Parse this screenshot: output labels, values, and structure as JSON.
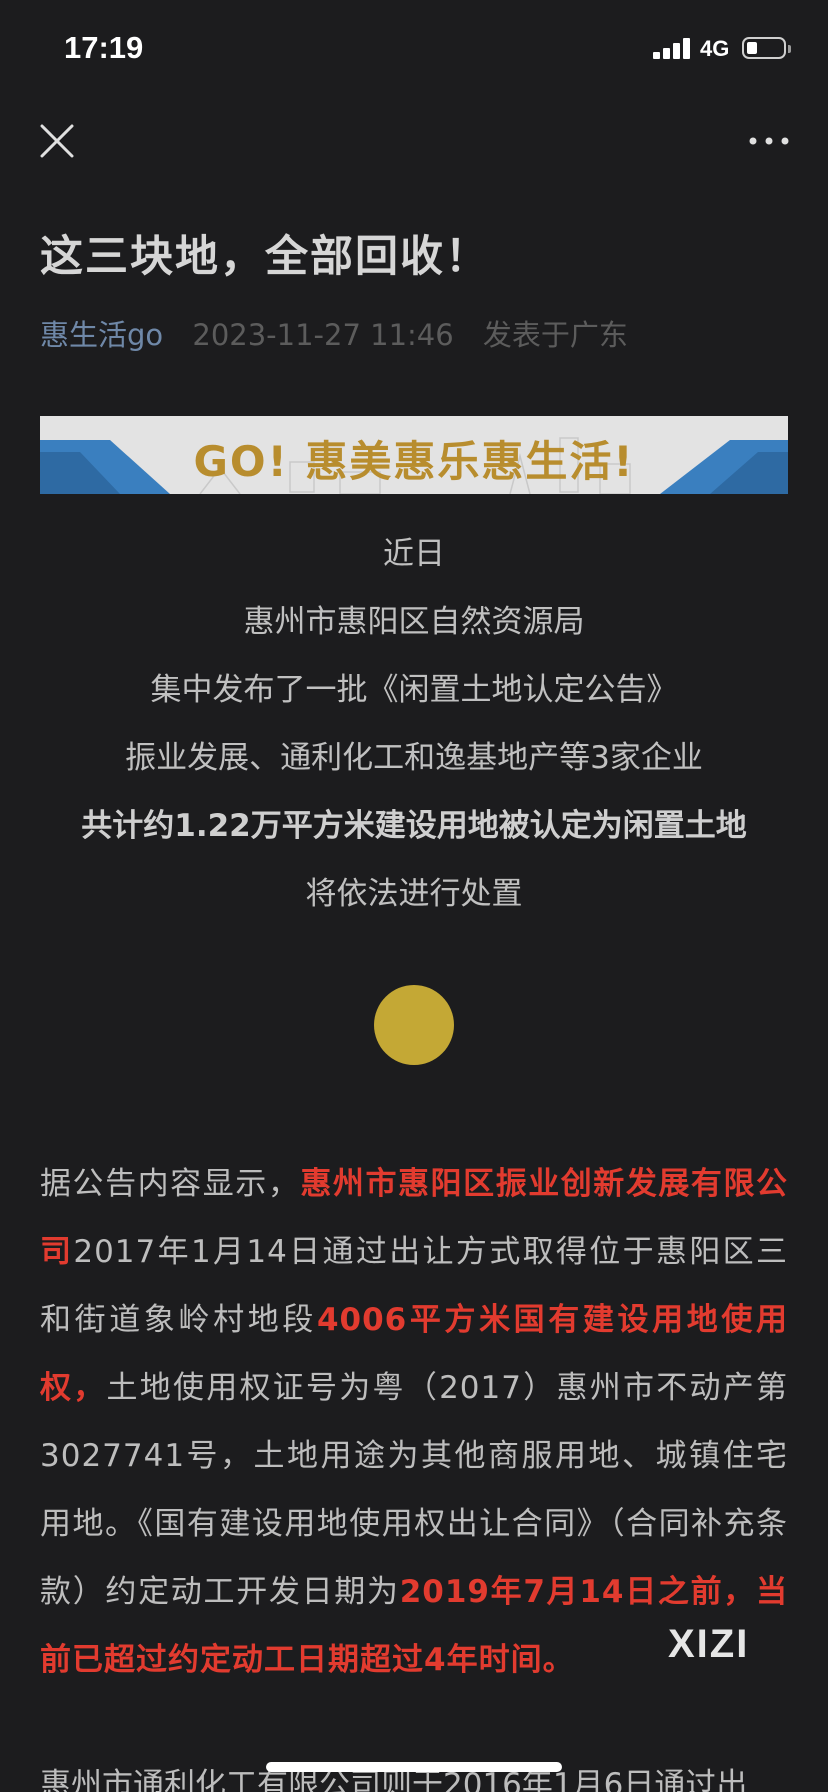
{
  "status_bar": {
    "time": "17:19",
    "network": "4G",
    "battery_level": 0.25
  },
  "nav": {
    "close_icon": "close-icon",
    "more_icon": "more-icon"
  },
  "article": {
    "title": "这三块地，全部回收！",
    "account": "惠生活go",
    "date": "2023-11-27 11:46",
    "region": "发表于广东",
    "banner_text": "GO! 惠美惠乐惠生活!",
    "intro_lines": [
      "近日",
      "惠州市惠阳区自然资源局",
      "集中发布了一批《闲置土地认定公告》",
      "振业发展、通利化工和逸基地产等3家企业",
      "共计约1.22万平方米建设用地被认定为闲置土地",
      "将依法进行处置"
    ],
    "body": {
      "p1_a": "据公告内容显示，",
      "p1_hl1": "惠州市惠阳区振业创新发展有限公司",
      "p1_b": "2017年1月14日通过出让方式取得位于惠阳区三和街道象岭村地段",
      "p1_hl2": "4006平方米国有建设用地使用权，",
      "p1_c": "土地使用权证号为粤（2017）惠州市不动产第3027741号，土地用途为其他商服用地、城镇住宅用地。《国有建设用地使用权出让合同》（合同补充条款）约定动工开发日期为",
      "p1_hl3": "2019年7月14日之前，当前已超过约定动工日期超过4年时间。",
      "p2_start": "惠州市通利化工有限公司则于2016年1月6日通过出"
    },
    "watermark": "XIZI"
  },
  "colors": {
    "background": "#1c1c1e",
    "highlight": "#e23b2f",
    "account": "#6f88a8",
    "circle": "#c4a835",
    "banner_text": "#b88d2e"
  }
}
